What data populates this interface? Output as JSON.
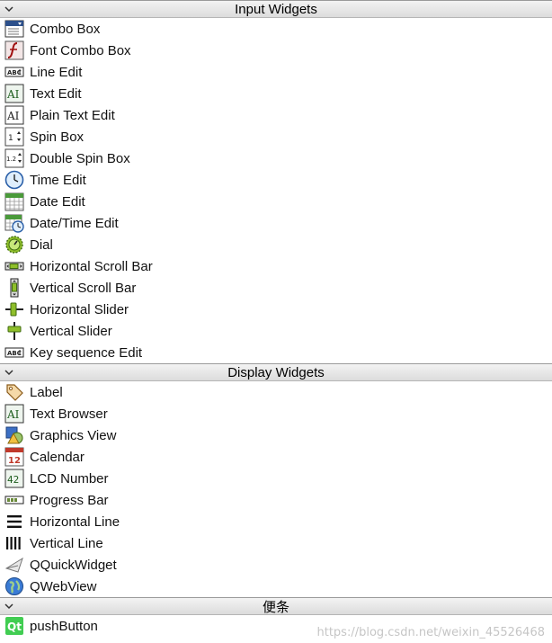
{
  "categories": [
    {
      "title": "Input Widgets",
      "items": [
        {
          "label": "Combo Box",
          "icon": "combo-box-icon"
        },
        {
          "label": "Font Combo Box",
          "icon": "font-combo-box-icon"
        },
        {
          "label": "Line Edit",
          "icon": "line-edit-icon"
        },
        {
          "label": "Text Edit",
          "icon": "text-edit-icon"
        },
        {
          "label": "Plain Text Edit",
          "icon": "plain-text-edit-icon"
        },
        {
          "label": "Spin Box",
          "icon": "spin-box-icon"
        },
        {
          "label": "Double Spin Box",
          "icon": "double-spin-box-icon"
        },
        {
          "label": "Time Edit",
          "icon": "time-edit-icon"
        },
        {
          "label": "Date Edit",
          "icon": "date-edit-icon"
        },
        {
          "label": "Date/Time Edit",
          "icon": "date-time-edit-icon"
        },
        {
          "label": "Dial",
          "icon": "dial-icon"
        },
        {
          "label": "Horizontal Scroll Bar",
          "icon": "horizontal-scroll-bar-icon"
        },
        {
          "label": "Vertical Scroll Bar",
          "icon": "vertical-scroll-bar-icon"
        },
        {
          "label": "Horizontal Slider",
          "icon": "horizontal-slider-icon"
        },
        {
          "label": "Vertical Slider",
          "icon": "vertical-slider-icon"
        },
        {
          "label": "Key sequence Edit",
          "icon": "key-sequence-edit-icon"
        }
      ]
    },
    {
      "title": "Display Widgets",
      "items": [
        {
          "label": "Label",
          "icon": "label-icon"
        },
        {
          "label": "Text Browser",
          "icon": "text-browser-icon"
        },
        {
          "label": "Graphics View",
          "icon": "graphics-view-icon"
        },
        {
          "label": "Calendar",
          "icon": "calendar-icon"
        },
        {
          "label": "LCD Number",
          "icon": "lcd-number-icon"
        },
        {
          "label": "Progress Bar",
          "icon": "progress-bar-icon"
        },
        {
          "label": "Horizontal Line",
          "icon": "horizontal-line-icon"
        },
        {
          "label": "Vertical Line",
          "icon": "vertical-line-icon"
        },
        {
          "label": "QQuickWidget",
          "icon": "qquickwidget-icon"
        },
        {
          "label": "QWebView",
          "icon": "qwebview-icon"
        }
      ]
    },
    {
      "title": "便条",
      "items": [
        {
          "label": "pushButton",
          "icon": "qt-icon"
        }
      ]
    }
  ],
  "icon_text": {
    "text_edit": "AI",
    "spin": "1",
    "double_spin": "1.2",
    "calendar": "12",
    "lcd": "42",
    "qt": "Qt",
    "abc": "ABC"
  },
  "watermark": "https://blog.csdn.net/weixin_45526468"
}
